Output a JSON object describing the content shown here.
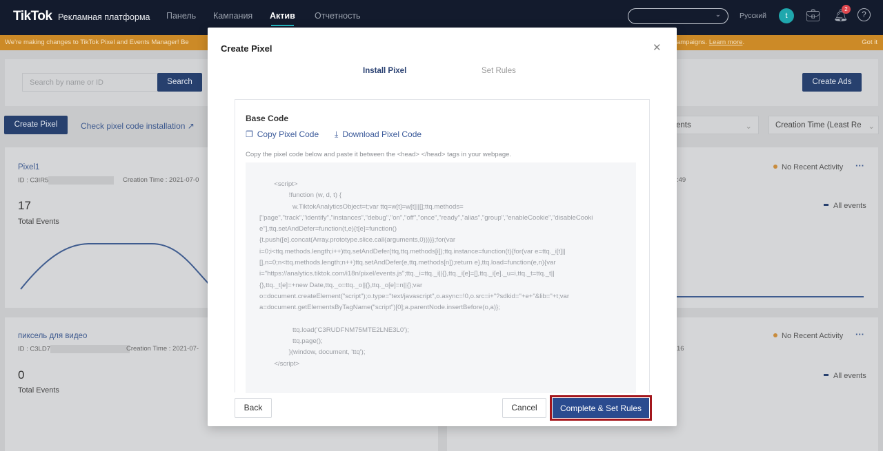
{
  "nav": {
    "logo": "TikTok",
    "logo_sub": "Рекламная платформа",
    "items": [
      "Панель",
      "Кампания",
      "Актив",
      "Отчетность"
    ],
    "active": "Актив",
    "language": "Русский",
    "avatar_letter": "t",
    "notification_count": "2"
  },
  "banner": {
    "text_left": "We're making changes to TikTok Pixel and Events Manager! Be",
    "text_right": "ampaigns.",
    "learn_more": "Learn more",
    "got_it": "Got it",
    "color": "#cc8a27"
  },
  "toolbar": {
    "search_placeholder": "Search by name or ID",
    "search_button": "Search",
    "create_ads": "Create Ads",
    "create_pixel": "Create Pixel",
    "check_installation": "Check pixel code installation",
    "filter_events": "ents",
    "sort": "Creation Time (Least Re"
  },
  "pixels": [
    {
      "name": "Pixel1",
      "id": "ID : C3IR5",
      "created": "Creation Time : 2021-07-0",
      "created_tail": ":49",
      "total": "17",
      "total_label": "Total Events",
      "status": "No Recent Activity",
      "legend": "All events"
    },
    {
      "name": "пиксель для видео",
      "id": "ID : C3LD7",
      "created": "Creation Time : 2021-07-",
      "created_tail": "16",
      "total": "0",
      "total_label": "Total Events",
      "status": "No Recent Activity",
      "legend": "All events"
    }
  ],
  "modal": {
    "title": "Create Pixel",
    "tabs": [
      "Install Pixel",
      "Set Rules"
    ],
    "active_tab": "Install Pixel",
    "base_code_title": "Base Code",
    "copy": "Copy Pixel Code",
    "download": "Download Pixel Code",
    "hint": "Copy the pixel code below and paste it between the <head> </head> tags in your webpage.",
    "code_lines": [
      "        <script>",
      "                !function (w, d, t) {",
      "                  w.TiktokAnalyticsObject=t;var ttq=w[t]=w[t]||[];ttq.methods=",
      "[\"page\",\"track\",\"identify\",\"instances\",\"debug\",\"on\",\"off\",\"once\",\"ready\",\"alias\",\"group\",\"enableCookie\",\"disableCooki",
      "e\"],ttq.setAndDefer=function(t,e){t[e]=function()",
      "{t.push([e].concat(Array.prototype.slice.call(arguments,0)))}};for(var",
      "i=0;i<ttq.methods.length;i++)ttq.setAndDefer(ttq,ttq.methods[i]);ttq.instance=function(t){for(var e=ttq._i[t]||",
      "[],n=0;n<ttq.methods.length;n++)ttq.setAndDefer(e,ttq.methods[n]);return e},ttq.load=function(e,n){var",
      "i=\"https://analytics.tiktok.com/i18n/pixel/events.js\";ttq._i=ttq._i||{},ttq._i[e]=[],ttq._i[e]._u=i,ttq._t=ttq._t||",
      "{},ttq._t[e]=+new Date,ttq._o=ttq._o||{},ttq._o[e]=n||{};var",
      "o=document.createElement(\"script\");o.type=\"text/javascript\",o.async=!0,o.src=i+\"?sdkid=\"+e+\"&lib=\"+t;var",
      "a=document.getElementsByTagName(\"script\")[0];a.parentNode.insertBefore(o,a)};",
      "",
      "                  ttq.load('C3RUDFNM75MTE2LNE3L0');",
      "                  ttq.page();",
      "                }(window, document, 'ttq');",
      "        </script>"
    ],
    "back": "Back",
    "cancel": "Cancel",
    "complete": "Complete & Set Rules"
  }
}
